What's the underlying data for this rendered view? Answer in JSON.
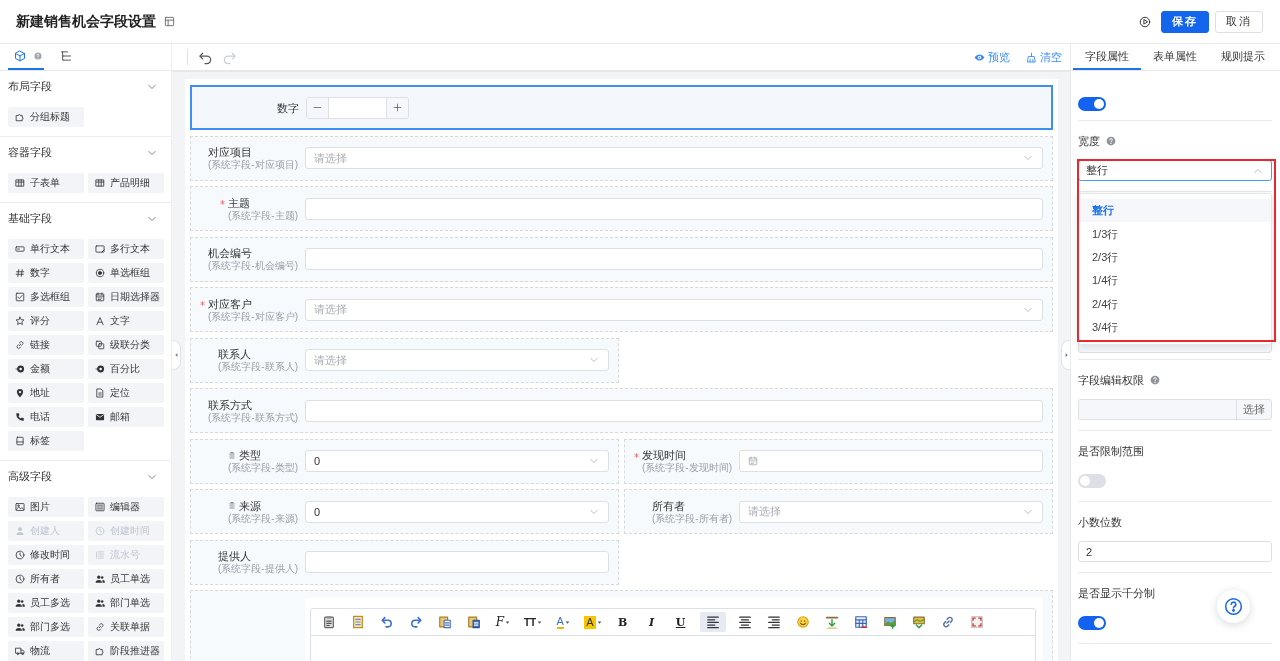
{
  "header": {
    "title": "新建销售机会字段设置",
    "actions": [
      {
        "kind": "save",
        "label": "保存"
      },
      {
        "kind": "cancel",
        "label": "取消"
      }
    ]
  },
  "sidebar": {
    "tabs": [
      {
        "kind": "components",
        "selected": true
      },
      {
        "kind": "outline",
        "selected": false
      }
    ],
    "sections": [
      {
        "title": "布局字段",
        "expanded": true,
        "items": [
          {
            "label": "分组标题",
            "kind": "group",
            "disabled": false
          }
        ]
      },
      {
        "title": "容器字段",
        "expanded": true,
        "items": [
          {
            "label": "子表单",
            "kind": "subform",
            "disabled": false
          },
          {
            "label": "产品明细",
            "kind": "product",
            "disabled": false
          }
        ]
      },
      {
        "title": "基础字段",
        "expanded": true,
        "items": [
          {
            "label": "单行文本",
            "kind": "text",
            "disabled": false
          },
          {
            "label": "多行文本",
            "kind": "textarea",
            "disabled": false
          },
          {
            "label": "数字",
            "kind": "number",
            "disabled": false
          },
          {
            "label": "单选框组",
            "kind": "radio",
            "disabled": false
          },
          {
            "label": "多选框组",
            "kind": "checkbox",
            "disabled": false
          },
          {
            "label": "日期选择器",
            "kind": "date",
            "disabled": false
          },
          {
            "label": "评分",
            "kind": "rate",
            "disabled": false
          },
          {
            "label": "文字",
            "kind": "label",
            "disabled": false
          },
          {
            "label": "链接",
            "kind": "link",
            "disabled": false
          },
          {
            "label": "级联分类",
            "kind": "cascader",
            "disabled": false
          },
          {
            "label": "金额",
            "kind": "money",
            "disabled": false
          },
          {
            "label": "百分比",
            "kind": "percent",
            "disabled": false
          },
          {
            "label": "地址",
            "kind": "address",
            "disabled": false
          },
          {
            "label": "定位",
            "kind": "location",
            "disabled": false
          },
          {
            "label": "电话",
            "kind": "phone",
            "disabled": false
          },
          {
            "label": "邮箱",
            "kind": "email",
            "disabled": false
          },
          {
            "label": "标签",
            "kind": "tag",
            "disabled": false
          }
        ]
      },
      {
        "title": "高级字段",
        "expanded": true,
        "items": [
          {
            "label": "图片",
            "kind": "image",
            "disabled": false
          },
          {
            "label": "编辑器",
            "kind": "editor",
            "disabled": false
          },
          {
            "label": "创建人",
            "kind": "creator",
            "disabled": true
          },
          {
            "label": "创建时间",
            "kind": "createtime",
            "disabled": true
          },
          {
            "label": "修改时间",
            "kind": "modifytime",
            "disabled": false
          },
          {
            "label": "流水号",
            "kind": "serial",
            "disabled": true
          },
          {
            "label": "所有者",
            "kind": "owner",
            "disabled": false
          },
          {
            "label": "员工单选",
            "kind": "user",
            "disabled": false
          },
          {
            "label": "员工多选",
            "kind": "users",
            "disabled": false
          },
          {
            "label": "部门单选",
            "kind": "dept",
            "disabled": false
          },
          {
            "label": "部门多选",
            "kind": "depts",
            "disabled": false
          },
          {
            "label": "关联单据",
            "kind": "relation",
            "disabled": false
          },
          {
            "label": "物流",
            "kind": "logistics",
            "disabled": false
          },
          {
            "label": "阶段推进器",
            "kind": "stage",
            "disabled": false
          }
        ]
      }
    ]
  },
  "canvas": {
    "history": [
      {
        "kind": "undo",
        "disabled": false
      },
      {
        "kind": "redo",
        "disabled": true
      }
    ],
    "actions": [
      {
        "kind": "preview",
        "label": "预览"
      },
      {
        "kind": "clear",
        "label": "清空"
      }
    ],
    "fields": [
      {
        "kind": "number",
        "label": "数字",
        "full_row": true,
        "selected": true,
        "required": false,
        "icon": false
      },
      {
        "kind": "select",
        "label": "对应项目",
        "sublabel": "(系统字段-对应项目)",
        "placeholder": "请选择",
        "full_row": true,
        "selected": false,
        "required": false,
        "icon": false
      },
      {
        "kind": "input",
        "label": "主题",
        "sublabel": "(系统字段-主题)",
        "full_row": true,
        "selected": false,
        "required": true,
        "icon": false
      },
      {
        "kind": "input",
        "label": "机会编号",
        "sublabel": "(系统字段-机会编号)",
        "full_row": true,
        "selected": false,
        "required": false,
        "icon": false
      },
      {
        "kind": "select",
        "label": "对应客户",
        "sublabel": "(系统字段-对应客户)",
        "placeholder": "请选择",
        "full_row": true,
        "selected": false,
        "required": true,
        "icon": false
      },
      {
        "kind": "select",
        "label": "联系人",
        "sublabel": "(系统字段-联系人)",
        "placeholder": "请选择",
        "full_row": false,
        "selected": false,
        "required": false,
        "icon": false
      },
      {
        "kind": "input",
        "label": "联系方式",
        "sublabel": "(系统字段-联系方式)",
        "full_row": true,
        "selected": false,
        "required": false,
        "icon": false
      },
      {
        "kind": "select",
        "label": "类型",
        "sublabel": "(系统字段-类型)",
        "value": "0",
        "full_row": false,
        "selected": false,
        "required": false,
        "icon": true
      },
      {
        "kind": "date",
        "label": "发现时间",
        "sublabel": "(系统字段-发现时间)",
        "full_row": false,
        "selected": false,
        "required": true,
        "icon": false
      },
      {
        "kind": "select",
        "label": "来源",
        "sublabel": "(系统字段-来源)",
        "value": "0",
        "full_row": false,
        "selected": false,
        "required": false,
        "icon": true
      },
      {
        "kind": "select",
        "label": "所有者",
        "sublabel": "(系统字段-所有者)",
        "placeholder": "请选择",
        "full_row": false,
        "selected": false,
        "required": false,
        "icon": false
      },
      {
        "kind": "input",
        "label": "提供人",
        "sublabel": "(系统字段-提供人)",
        "full_row": false,
        "selected": false,
        "required": false,
        "icon": false
      },
      {
        "kind": "editor",
        "full_row": true,
        "selected": false,
        "required": false,
        "icon": false,
        "toolbar": [
          {
            "kind": "clipboard",
            "selected": false
          },
          {
            "kind": "template",
            "selected": false
          },
          {
            "kind": "undo",
            "selected": false
          },
          {
            "kind": "redo",
            "selected": false
          },
          {
            "kind": "paste",
            "selected": false
          },
          {
            "kind": "pasteword",
            "selected": false
          },
          {
            "kind": "fontfamily",
            "label": "F",
            "selected": false
          },
          {
            "kind": "fontsize",
            "label": "TT",
            "selected": false
          },
          {
            "kind": "fontcolor",
            "label": "A",
            "selected": false
          },
          {
            "kind": "highlight",
            "label": "A",
            "selected": false
          },
          {
            "kind": "bold",
            "label": "B",
            "selected": false
          },
          {
            "kind": "italic",
            "label": "I",
            "selected": false
          },
          {
            "kind": "underline",
            "label": "U",
            "selected": false
          },
          {
            "kind": "alignleft",
            "selected": true
          },
          {
            "kind": "aligncenter",
            "selected": false
          },
          {
            "kind": "alignright",
            "selected": false
          },
          {
            "kind": "emoji",
            "selected": false
          },
          {
            "kind": "insertrow",
            "selected": false
          },
          {
            "kind": "table",
            "selected": false
          },
          {
            "kind": "imageadd",
            "selected": false
          },
          {
            "kind": "imagerow",
            "selected": false
          },
          {
            "kind": "link",
            "selected": false
          },
          {
            "kind": "fullscreen",
            "selected": false
          }
        ]
      }
    ]
  },
  "properties": {
    "tabs": [
      {
        "label": "字段属性",
        "selected": true
      },
      {
        "label": "表单属性",
        "selected": false
      },
      {
        "label": "规则提示",
        "selected": false
      }
    ],
    "sections": [
      {
        "kind": "switch",
        "on": true
      },
      {
        "kind": "select",
        "label": "宽度",
        "help": true,
        "value": "整行",
        "expanded": true,
        "options": [
          {
            "label": "整行",
            "selected": true
          },
          {
            "label": "1/3行",
            "selected": false
          },
          {
            "label": "2/3行",
            "selected": false
          },
          {
            "label": "1/4行",
            "selected": false
          },
          {
            "label": "2/4行",
            "selected": false
          },
          {
            "label": "3/4行",
            "selected": false
          }
        ]
      },
      {
        "kind": "picker",
        "covered": true
      },
      {
        "kind": "picker",
        "label": "字段编辑权限",
        "help": true,
        "button": "选择",
        "covered": false
      },
      {
        "kind": "switch",
        "label": "是否限制范围",
        "help": false,
        "on": false
      },
      {
        "kind": "input",
        "label": "小数位数",
        "help": false,
        "value": "2"
      },
      {
        "kind": "switch",
        "label": "是否显示千分制",
        "help": false,
        "on": true
      }
    ]
  }
}
